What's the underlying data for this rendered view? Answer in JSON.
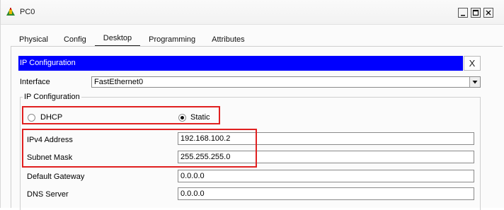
{
  "window": {
    "title": "PC0"
  },
  "tabs": [
    {
      "label": "Physical"
    },
    {
      "label": "Config"
    },
    {
      "label": "Desktop"
    },
    {
      "label": "Programming"
    },
    {
      "label": "Attributes"
    }
  ],
  "active_tab": "Desktop",
  "ip_config": {
    "header": "IP Configuration",
    "close_glyph": "X",
    "interface_label": "Interface",
    "interface_value": "FastEthernet0",
    "group_label": "IP Configuration",
    "dhcp_label": "DHCP",
    "static_label": "Static",
    "selected_mode": "Static",
    "fields": {
      "ipv4_label": "IPv4 Address",
      "ipv4_value": "192.168.100.2",
      "subnet_label": "Subnet Mask",
      "subnet_value": "255.255.255.0",
      "gateway_label": "Default Gateway",
      "gateway_value": "0.0.0.0",
      "dns_label": "DNS Server",
      "dns_value": "0.0.0.0"
    }
  },
  "colors": {
    "header_bg": "#0000ff",
    "highlight_border": "#e02020"
  }
}
